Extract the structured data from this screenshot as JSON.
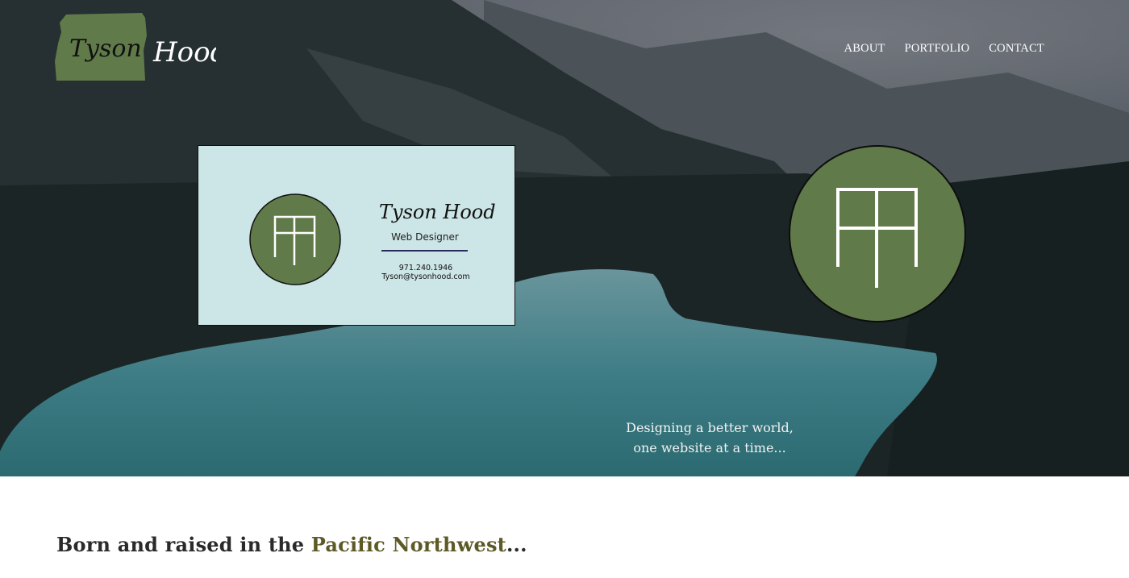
{
  "brand": {
    "logo_text_first": "Tyson",
    "logo_text_last": "Hood",
    "logo_icon": "oregon-state-shape-icon",
    "accent_green": "#617a4a"
  },
  "nav": {
    "items": [
      "ABOUT",
      "PORTFOLIO",
      "CONTACT"
    ]
  },
  "hero": {
    "card": {
      "name": "Tyson Hood",
      "role": "Web Designer",
      "phone": "971.240.1946",
      "email": "Tyson@tysonhood.com",
      "bg_color": "#cce5e6"
    },
    "monogram_icon": "th-monogram-icon",
    "tagline_line1": "Designing a better world,",
    "tagline_line2": "one website at a time..."
  },
  "intro": {
    "heading_start": "Born and raised in the ",
    "heading_accent": "Pacific Northwest",
    "heading_end": "...",
    "accent_color": "#5e5a26"
  }
}
